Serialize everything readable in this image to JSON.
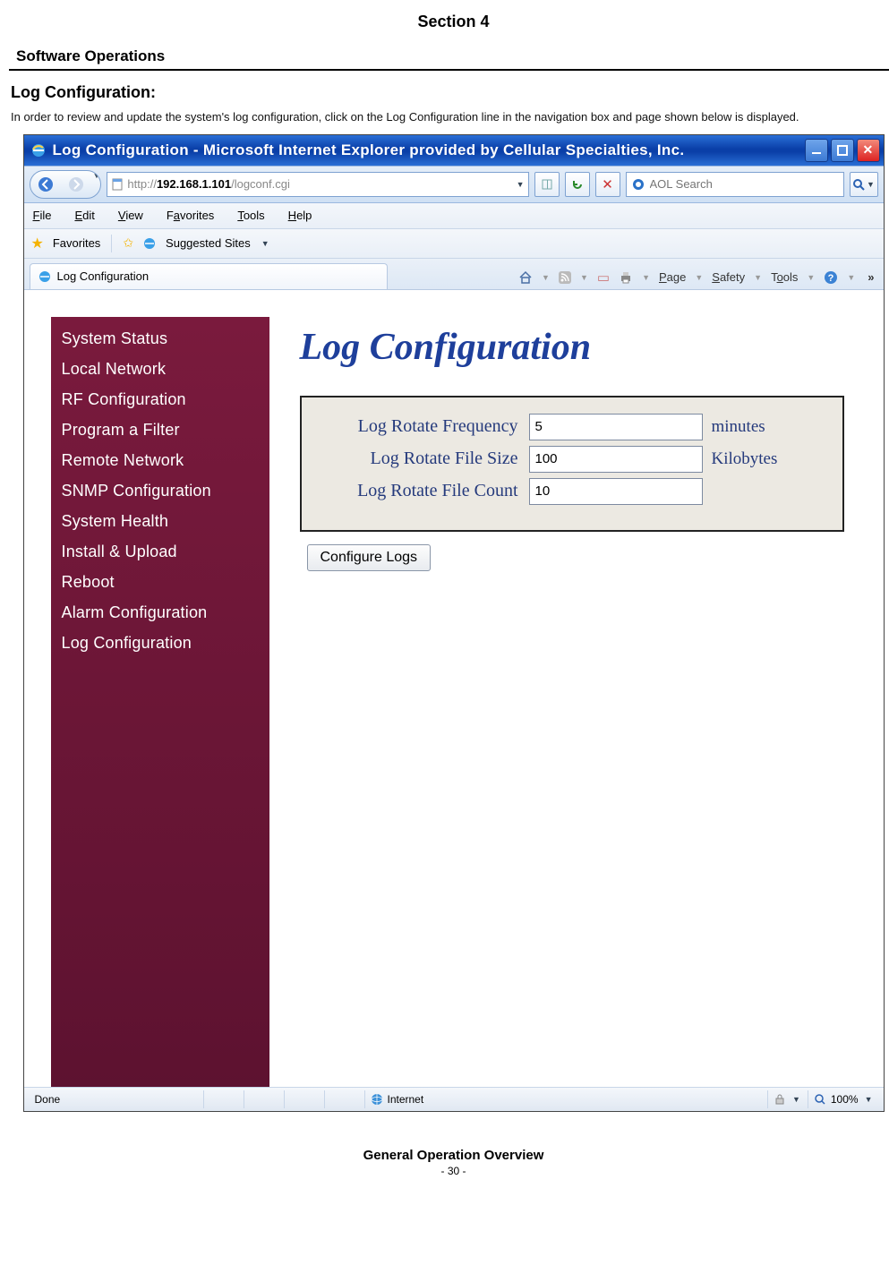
{
  "doc": {
    "section": "Section 4",
    "subhead": "Software Operations",
    "h2": "Log Configuration:",
    "body": "In order to review and update the system's log configuration, click on the Log Configuration line in the navigation box and page shown below is displayed.",
    "footer_title": "General Operation Overview",
    "footer_page": "- 30 -"
  },
  "window": {
    "title": "Log Configuration - Microsoft Internet Explorer provided by Cellular Specialties, Inc."
  },
  "address": {
    "prefix": "http://",
    "host": "192.168.1.101",
    "path": "/logconf.cgi"
  },
  "search": {
    "placeholder": "AOL Search"
  },
  "menu": {
    "file": "File",
    "edit": "Edit",
    "view": "View",
    "favorites": "Favorites",
    "tools": "Tools",
    "help": "Help"
  },
  "favbar": {
    "favorites": "Favorites",
    "suggested": "Suggested Sites"
  },
  "tab": {
    "label": "Log Configuration"
  },
  "cmdbar": {
    "page": "Page",
    "safety": "Safety",
    "tools": "Tools"
  },
  "sidebar": {
    "items": [
      {
        "label": "System Status"
      },
      {
        "label": "Local Network"
      },
      {
        "label": "RF Configuration"
      },
      {
        "label": "Program a Filter"
      },
      {
        "label": "Remote Network"
      },
      {
        "label": "SNMP Configuration"
      },
      {
        "label": "System Health"
      },
      {
        "label": "Install & Upload"
      },
      {
        "label": "Reboot"
      },
      {
        "label": "Alarm Configuration"
      },
      {
        "label": "Log Configuration"
      }
    ]
  },
  "pageContent": {
    "title": "Log Configuration",
    "rows": [
      {
        "label": "Log Rotate Frequency",
        "value": "5",
        "unit": "minutes"
      },
      {
        "label": "Log Rotate File Size",
        "value": "100",
        "unit": "Kilobytes"
      },
      {
        "label": "Log Rotate File Count",
        "value": "10",
        "unit": ""
      }
    ],
    "button": "Configure Logs"
  },
  "status": {
    "done": "Done",
    "zone": "Internet",
    "zoom": "100%"
  }
}
